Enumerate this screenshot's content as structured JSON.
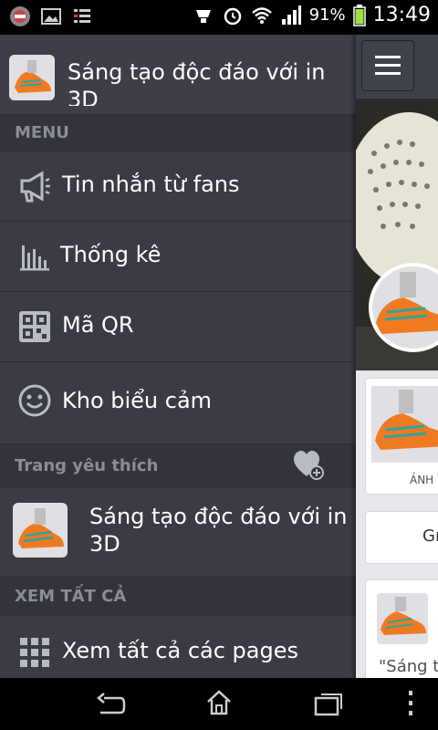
{
  "status": {
    "battery": "91%",
    "time": "13:49"
  },
  "drawer": {
    "page_title": "Sáng tạo độc đáo với in 3D",
    "menu_header": "MENU",
    "menu_items": [
      {
        "label": "Tin nhắn từ fans",
        "icon": "megaphone-icon"
      },
      {
        "label": "Thống kê",
        "icon": "bar-chart-icon"
      },
      {
        "label": "Mã QR",
        "icon": "qr-code-icon"
      },
      {
        "label": "Kho biểu cảm",
        "icon": "smiley-icon"
      }
    ],
    "favorites_header": "Trang yêu thích",
    "favorite_page": "Sáng tạo độc đáo với in 3D",
    "see_all_header": "XEM TẤT CẢ",
    "see_all_item": "Xem tất cả các pages"
  },
  "right_panel": {
    "photo_label": "ẢNH",
    "button_label": "Gı",
    "quote_fragment": "\"Sáng tạ"
  }
}
